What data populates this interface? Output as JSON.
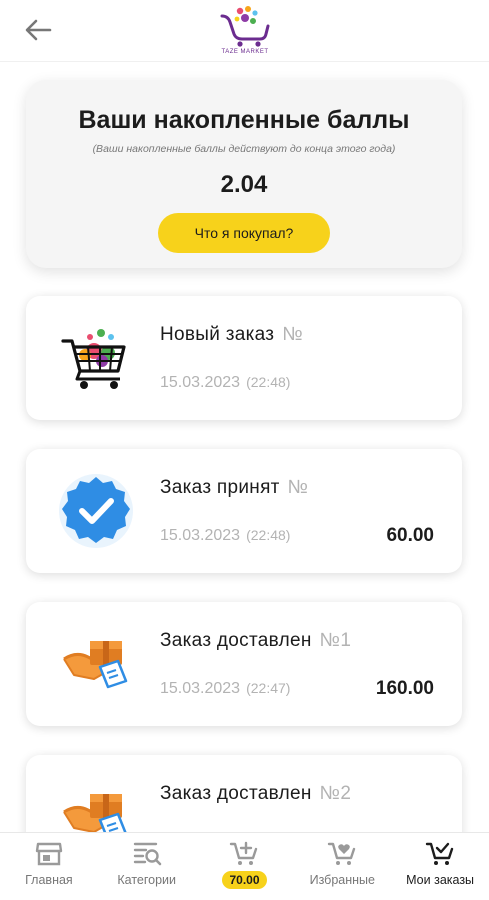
{
  "header": {
    "logo_text": "TAZE MARKET",
    "logo_colors": [
      "#e94d6f",
      "#f7a51b",
      "#5cc2ee",
      "#8e3ca6",
      "#4caf50"
    ]
  },
  "points": {
    "title": "Ваши накопленные баллы",
    "note": "(Ваши накопленные баллы действуют до конца этого года)",
    "value": "2.04",
    "button_label": "Что я покупал?"
  },
  "orders": [
    {
      "status": "Новый заказ",
      "number": "№",
      "date": "15.03.2023",
      "time": "(22:48)",
      "amount": "",
      "icon": "cart-icon"
    },
    {
      "status": "Заказ принят",
      "number": "№",
      "date": "15.03.2023",
      "time": "(22:48)",
      "amount": "60.00",
      "icon": "verified-check-icon"
    },
    {
      "status": "Заказ доставлен",
      "number": "№1",
      "date": "15.03.2023",
      "time": "(22:47)",
      "amount": "160.00",
      "icon": "delivery-box-icon"
    },
    {
      "status": "Заказ доставлен",
      "number": "№2",
      "date": "",
      "time": "",
      "amount": "",
      "icon": "delivery-box-icon"
    }
  ],
  "nav": {
    "home": "Главная",
    "categories": "Категории",
    "cart_total": "70.00",
    "favorites": "Избранные",
    "orders": "Мои заказы"
  },
  "colors": {
    "accent_yellow": "#f7d21b",
    "muted_text": "#b3b3b3",
    "verified_blue": "#2f8de4",
    "box_orange": "#f49a3c"
  }
}
